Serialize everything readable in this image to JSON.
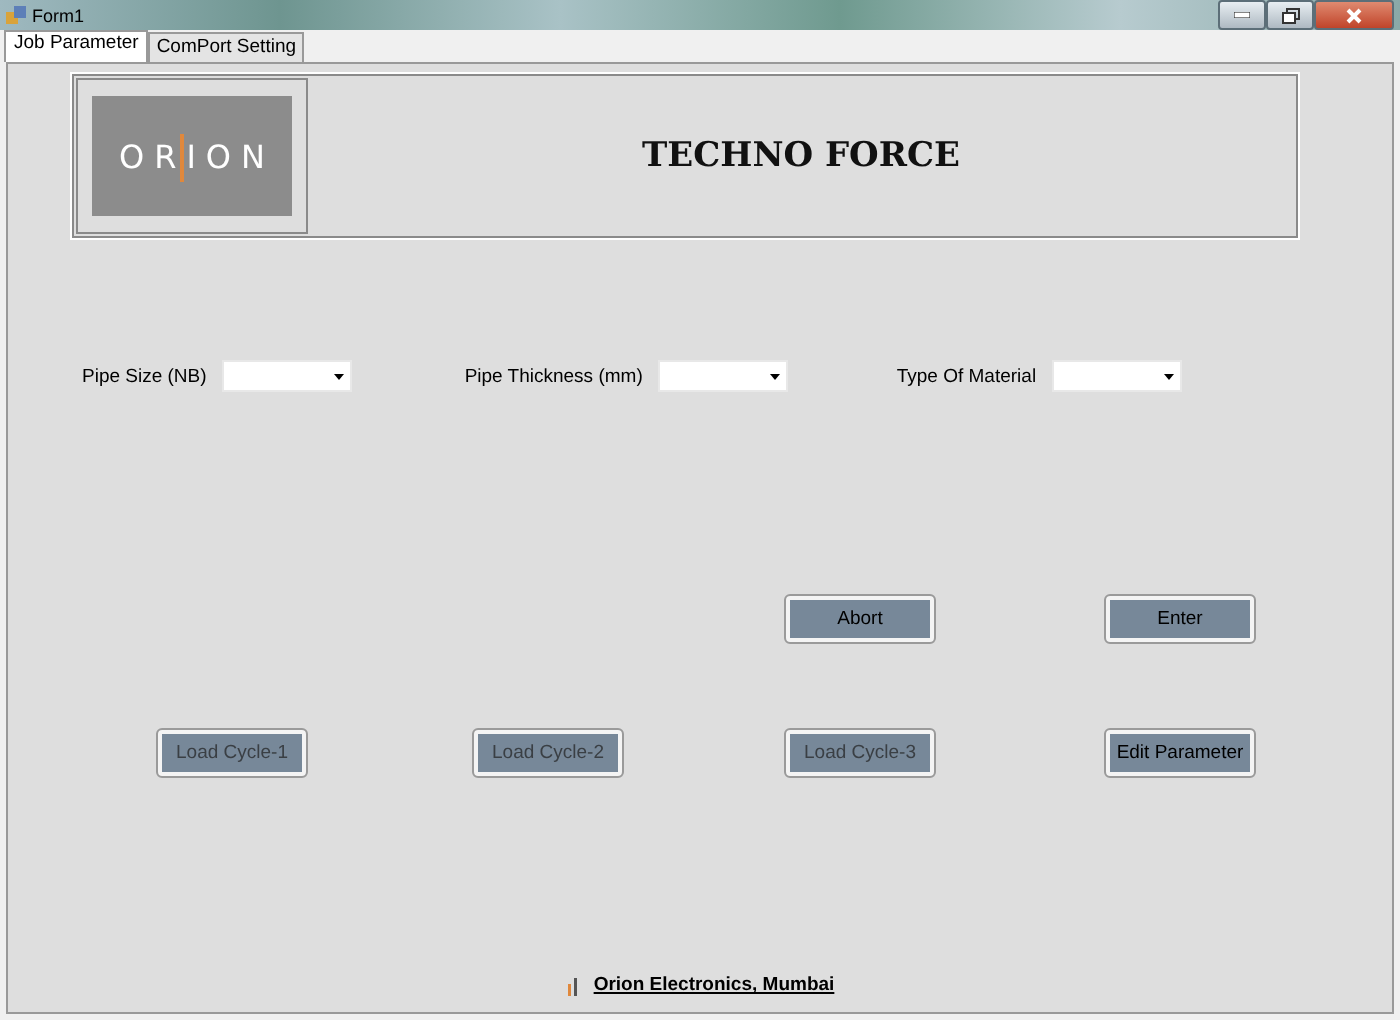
{
  "window": {
    "title": "Form1"
  },
  "tabs": [
    {
      "label": "Job Parameter",
      "selected": true
    },
    {
      "label": "ComPort Setting",
      "selected": false
    }
  ],
  "header": {
    "logo": "ORION",
    "title": "TECHNO FORCE"
  },
  "fields": [
    {
      "label": "Pipe Size (NB)"
    },
    {
      "label": "Pipe Thickness (mm)"
    },
    {
      "label": "Type Of Material"
    }
  ],
  "action_buttons": [
    {
      "label": "Abort",
      "disabled": false
    },
    {
      "label": "Enter",
      "disabled": false
    }
  ],
  "cycle_buttons": [
    {
      "label": "Load Cycle-1",
      "disabled": true
    },
    {
      "label": "Load Cycle-2",
      "disabled": true
    },
    {
      "label": "Load Cycle-3",
      "disabled": true
    },
    {
      "label": "Edit Parameter",
      "disabled": false
    }
  ],
  "footer": {
    "link": "Orion Electronics, Mumbai"
  }
}
